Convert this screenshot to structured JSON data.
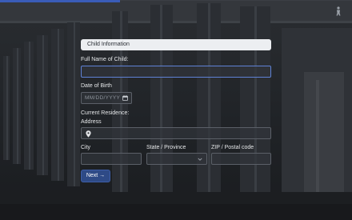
{
  "form": {
    "section_title": "Child Information",
    "full_name_label": "Full Name of Child:",
    "full_name_value": "",
    "dob_label": "Date of Birth",
    "dob_placeholder": "MM/DD/YYYY",
    "residence_label": "Current Residence:",
    "address_label": "Address",
    "address_value": "",
    "city_label": "City",
    "city_value": "",
    "state_label": "State / Province",
    "state_value": "",
    "zip_label": "ZIP / Postal code",
    "zip_value": "",
    "next_label": "Next →"
  },
  "icons": {
    "corner": "figure-icon",
    "dob": "calendar-icon",
    "address": "map-pin-icon",
    "state": "chevron-down-icon"
  },
  "colors": {
    "accent": "#3a5cb8",
    "button": "#2e4a86",
    "focus_border": "#5f82d6"
  }
}
